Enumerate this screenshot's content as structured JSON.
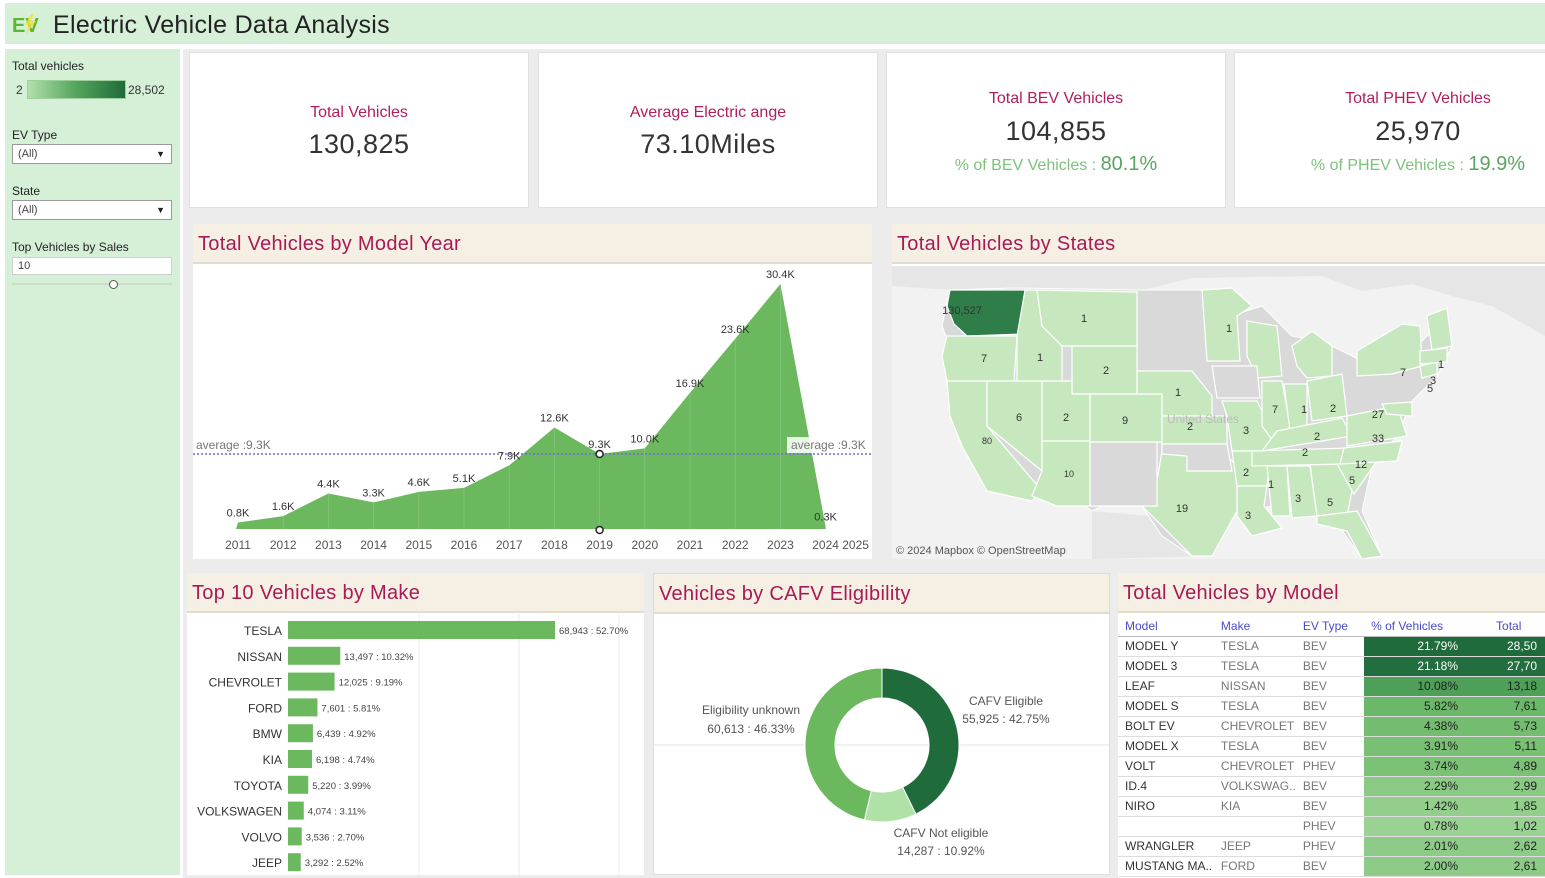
{
  "header": {
    "title": "Electric Vehicle Data Analysis",
    "logo_text": "EV"
  },
  "sidebar": {
    "legend_label": "Total vehicles",
    "legend_min": "2",
    "legend_max": "28,502",
    "ev_type_label": "EV Type",
    "ev_type_value": "(All)",
    "state_label": "State",
    "state_value": "(All)",
    "top_label": "Top Vehicles by Sales",
    "top_value": "10"
  },
  "kpis": {
    "total": {
      "label": "Total Vehicles",
      "value": "130,825"
    },
    "range": {
      "label": "Average Electric ange",
      "value": "73.10Miles"
    },
    "bev": {
      "label": "Total BEV Vehicles",
      "value": "104,855",
      "pct_label": "% of BEV Vehicles :",
      "pct_value": "80.1%"
    },
    "phev": {
      "label": "Total PHEV Vehicles",
      "value": "25,970",
      "pct_label": "% of PHEV Vehicles :",
      "pct_value": "19.9%"
    }
  },
  "colors": {
    "title_accent": "#a81a55",
    "green_light": "#d6f0d8",
    "area_fill": "#6cb85f",
    "dark_green": "#1f6b3b"
  },
  "model_year": {
    "title": "Total Vehicles by Model Year",
    "average_label": "average :9.3K",
    "last_tick": "2025"
  },
  "states_map": {
    "title": "Total Vehicles by States",
    "attribution": "© 2024 Mapbox  © OpenStreetMap",
    "country_label": "United States",
    "wa_label": "130,527"
  },
  "make_panel": {
    "title": "Top 10 Vehicles by Make"
  },
  "cafv_panel": {
    "title": "Vehicles by CAFV Eligibility"
  },
  "model_panel": {
    "title": "Total Vehicles by Model",
    "columns": [
      "Model",
      "Make",
      "EV Type",
      "% of Vehicles",
      "Total"
    ],
    "rows": [
      {
        "model": "MODEL Y",
        "make": "TESLA",
        "type": "BEV",
        "pct": "21.79%",
        "total": "28,50",
        "color": "#1f6b3b"
      },
      {
        "model": "MODEL 3",
        "make": "TESLA",
        "type": "BEV",
        "pct": "21.18%",
        "total": "27,70",
        "color": "#226e3e"
      },
      {
        "model": "LEAF",
        "make": "NISSAN",
        "type": "BEV",
        "pct": "10.08%",
        "total": "13,18",
        "color": "#4e9f57"
      },
      {
        "model": "MODEL S",
        "make": "TESLA",
        "type": "BEV",
        "pct": "5.82%",
        "total": "7,61",
        "color": "#6cb86a"
      },
      {
        "model": "BOLT EV",
        "make": "CHEVROLET",
        "type": "BEV",
        "pct": "4.38%",
        "total": "5,73",
        "color": "#74bd70"
      },
      {
        "model": "MODEL X",
        "make": "TESLA",
        "type": "BEV",
        "pct": "3.91%",
        "total": "5,11",
        "color": "#79c075"
      },
      {
        "model": "VOLT",
        "make": "CHEVROLET",
        "type": "PHEV",
        "pct": "3.74%",
        "total": "4,89",
        "color": "#7bc277"
      },
      {
        "model": "ID.4",
        "make": "VOLKSWAG..",
        "type": "BEV",
        "pct": "2.29%",
        "total": "2,99",
        "color": "#8bca85"
      },
      {
        "model": "NIRO",
        "make": "KIA",
        "type": "BEV",
        "pct": "1.42%",
        "total": "1,85",
        "color": "#93ce8d"
      },
      {
        "model": "",
        "make": "",
        "type": "PHEV",
        "pct": "0.78%",
        "total": "1,02",
        "color": "#9ad293"
      },
      {
        "model": "WRANGLER",
        "make": "JEEP",
        "type": "PHEV",
        "pct": "2.01%",
        "total": "2,62",
        "color": "#8ecb88"
      },
      {
        "model": "MUSTANG MA..",
        "make": "FORD",
        "type": "BEV",
        "pct": "2.00%",
        "total": "2,61",
        "color": "#8ecb88"
      }
    ]
  },
  "chart_data": [
    {
      "type": "area",
      "title": "Total Vehicles by Model Year",
      "x": [
        "2011",
        "2012",
        "2013",
        "2014",
        "2015",
        "2016",
        "2017",
        "2018",
        "2019",
        "2020",
        "2021",
        "2022",
        "2023",
        "2024"
      ],
      "values": [
        0.8,
        1.6,
        4.4,
        3.3,
        4.6,
        5.1,
        7.9,
        12.6,
        9.3,
        10.0,
        16.9,
        23.6,
        30.4,
        0.3
      ],
      "labels": [
        "0.8K",
        "1.6K",
        "4.4K",
        "3.3K",
        "4.6K",
        "5.1K",
        "7.9K",
        "12.6K",
        "9.3K",
        "10.0K",
        "16.9K",
        "23.6K",
        "30.4K",
        "0.3K"
      ],
      "reference_line": 9.3,
      "color": "#6cb85f"
    },
    {
      "type": "bar",
      "title": "Top 10 Vehicles by Make",
      "categories": [
        "TESLA",
        "NISSAN",
        "CHEVROLET",
        "FORD",
        "BMW",
        "KIA",
        "TOYOTA",
        "VOLKSWAGEN",
        "VOLVO",
        "JEEP"
      ],
      "values": [
        68943,
        13497,
        12025,
        7601,
        6439,
        6198,
        5220,
        4074,
        3536,
        3292
      ],
      "labels": [
        "68,943 : 52.70%",
        "13,497 : 10.32%",
        "12,025 : 9.19%",
        "7,601 : 5.81%",
        "6,439 : 4.92%",
        "6,198 : 4.74%",
        "5,220 : 3.99%",
        "4,074 : 3.11%",
        "3,536 : 2.70%",
        "3,292 : 2.52%"
      ],
      "color": "#6cb85f"
    },
    {
      "type": "pie",
      "title": "Vehicles by CAFV Eligibility",
      "categories": [
        "CAFV Eligible",
        "CAFV Not eligible",
        "Eligibility unknown"
      ],
      "values": [
        55925,
        14287,
        60613
      ],
      "labels": [
        "55,925 : 42.75%",
        "14,287 : 10.92%",
        "60,613 : 46.33%"
      ],
      "colors": [
        "#1f6b3b",
        "#b0e2a7",
        "#6cb85f"
      ]
    },
    {
      "type": "table",
      "title": "Total Vehicles by States",
      "categories": [
        "WA",
        "CA",
        "OR",
        "NV",
        "ID",
        "MT",
        "WY",
        "UT",
        "CO",
        "AZ",
        "NE",
        "KS",
        "TX",
        "MN",
        "MO",
        "AR",
        "LA",
        "MS",
        "AL",
        "GA",
        "TN",
        "IL",
        "IN",
        "OH",
        "KY",
        "SC",
        "NC",
        "VA",
        "MD",
        "NY",
        "CT",
        "MA",
        "NH"
      ],
      "values": [
        130527,
        80,
        7,
        6,
        1,
        1,
        2,
        2,
        9,
        10,
        1,
        2,
        19,
        1,
        3,
        2,
        3,
        1,
        3,
        5,
        2,
        7,
        1,
        2,
        2,
        5,
        12,
        33,
        27,
        7,
        3,
        5,
        1
      ]
    }
  ]
}
